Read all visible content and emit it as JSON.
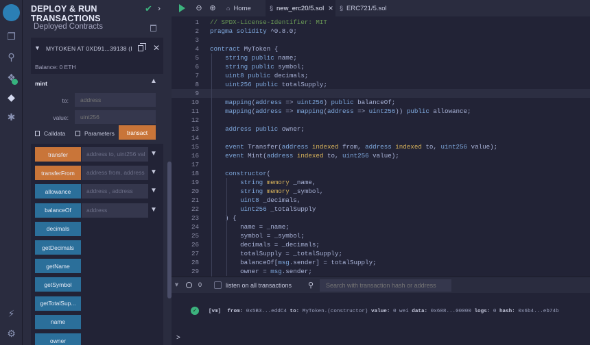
{
  "sidebar": {
    "title": "DEPLOY & RUN TRANSACTIONS",
    "deployed_label": "Deployed Contracts",
    "instance_title": "MYTOKEN AT 0XD91...39138 (I",
    "balance": "Balance: 0 ETH",
    "mint": {
      "title": "mint",
      "to_label": "to:",
      "to_placeholder": "address",
      "value_label": "value:",
      "value_placeholder": "uint256",
      "calldata_label": "Calldata",
      "parameters_label": "Parameters",
      "transact_label": "transact"
    },
    "functions": [
      {
        "label": "transfer",
        "color": "orange",
        "input": "address to, uint256 val"
      },
      {
        "label": "transferFrom",
        "color": "orange",
        "input": "address from, address"
      },
      {
        "label": "allowance",
        "color": "blue",
        "input": "address , address"
      },
      {
        "label": "balanceOf",
        "color": "blue",
        "input": "address"
      },
      {
        "label": "decimals",
        "color": "blue",
        "input": null
      },
      {
        "label": "getDecimals",
        "color": "blue",
        "input": null
      },
      {
        "label": "getName",
        "color": "blue",
        "input": null
      },
      {
        "label": "getSymbol",
        "color": "blue",
        "input": null
      },
      {
        "label": "getTotalSup...",
        "color": "blue",
        "input": null
      },
      {
        "label": "name",
        "color": "blue",
        "input": null
      },
      {
        "label": "owner",
        "color": "blue",
        "input": null
      }
    ]
  },
  "tabs": [
    {
      "label": "Home"
    },
    {
      "label": "new_erc20/5.sol"
    },
    {
      "label": "ERC721/5.sol"
    }
  ],
  "code_lines": [
    "// SPDX-License-Identifier: MIT",
    "pragma solidity ^0.8.0;",
    "",
    "contract MyToken {",
    "    string public name;",
    "    string public symbol;",
    "    uint8 public decimals;",
    "    uint256 public totalSupply;",
    "",
    "    mapping(address => uint256) public balanceOf;",
    "    mapping(address => mapping(address => uint256)) public allowance;",
    "",
    "    address public owner;",
    "",
    "    event Transfer(address indexed from, address indexed to, uint256 value);",
    "    event Mint(address indexed to, uint256 value);",
    "",
    "    constructor(",
    "        string memory _name,",
    "        string memory _symbol,",
    "        uint8 _decimals,",
    "        uint256 _totalSupply",
    "    ) {",
    "        name = _name;",
    "        symbol = _symbol;",
    "        decimals = _decimals;",
    "        totalSupply = _totalSupply;",
    "        balanceOf[msg.sender] = totalSupply;",
    "        owner = msg.sender;",
    "    }"
  ],
  "terminal": {
    "count": "0",
    "listen_label": "listen on all transactions",
    "search_placeholder": "Search with transaction hash or address",
    "log": {
      "tag": "[vm]",
      "from_key": "from:",
      "from_val": "0x5B3...eddC4",
      "to_key": "to:",
      "to_val": "MyToken.(constructor)",
      "value_key": "value:",
      "value_val": "0 wei",
      "data_key": "data:",
      "data_val": "0x608...00000",
      "logs_key": "logs:",
      "logs_val": "0",
      "hash_key": "hash:",
      "hash_val": "0x6b4...eb74b"
    },
    "prompt": ">"
  },
  "colors": {
    "accent_green": "#3cb37e",
    "transact_orange": "#c97539",
    "call_blue": "#2b6f9a",
    "background": "#222336",
    "panel": "#2a2c3f"
  }
}
